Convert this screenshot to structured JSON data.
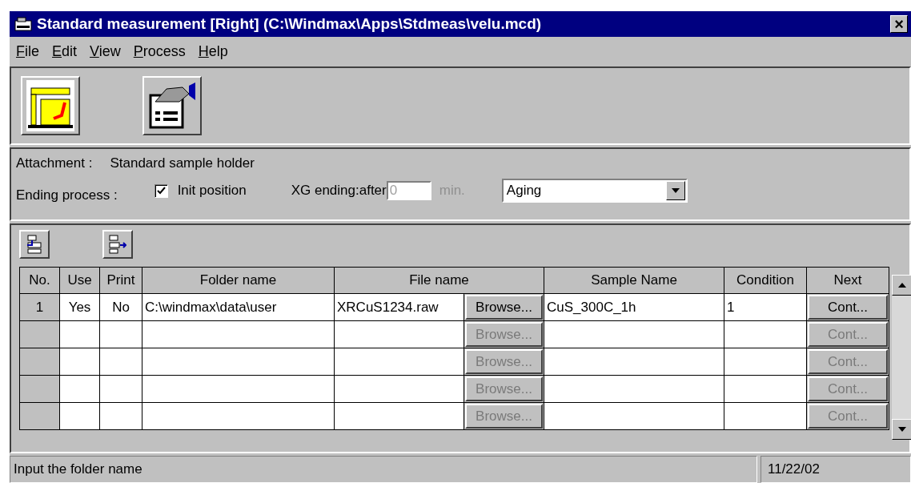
{
  "window": {
    "title": "Standard measurement [Right] (C:\\Windmax\\Apps\\Stdmeas\\velu.mcd)",
    "close": "×"
  },
  "menu": [
    {
      "label": "File"
    },
    {
      "label": "Edit"
    },
    {
      "label": "View"
    },
    {
      "label": "Process"
    },
    {
      "label": "Help"
    }
  ],
  "settings": {
    "attachment_label": "Attachment :",
    "attachment_value": "Standard sample holder",
    "ending_label": "Ending process :",
    "init_position": {
      "label": "Init position",
      "checked": true
    },
    "xg_ending": {
      "label": "XG ending:after",
      "value": "0",
      "unit": "min.",
      "disabled": true
    },
    "dropdown": {
      "value": "Aging"
    }
  },
  "table": {
    "columns": [
      "No.",
      "Use",
      "Print",
      "Folder name",
      "File name",
      "Sample Name",
      "Condition",
      "Next"
    ],
    "rows": [
      {
        "no": "1",
        "use": "Yes",
        "print": "No",
        "folder": "C:\\windmax\\data\\user",
        "file": "XRCuS1234.raw",
        "browse": {
          "label": "Browse...",
          "disabled": false
        },
        "sample": "CuS_300C_1h",
        "condition": "1",
        "next": {
          "label": "Cont...",
          "disabled": false
        }
      },
      {
        "browse": {
          "label": "Browse...",
          "disabled": true
        },
        "next": {
          "label": "Cont...",
          "disabled": true
        }
      },
      {
        "browse": {
          "label": "Browse...",
          "disabled": true
        },
        "next": {
          "label": "Cont...",
          "disabled": true
        }
      },
      {
        "browse": {
          "label": "Browse...",
          "disabled": true
        },
        "next": {
          "label": "Cont...",
          "disabled": true
        }
      },
      {
        "browse": {
          "label": "Browse...",
          "disabled": true
        },
        "next": {
          "label": "Cont...",
          "disabled": true
        }
      }
    ]
  },
  "status_bar": {
    "message": "Input the folder name",
    "date": "11/22/02"
  }
}
